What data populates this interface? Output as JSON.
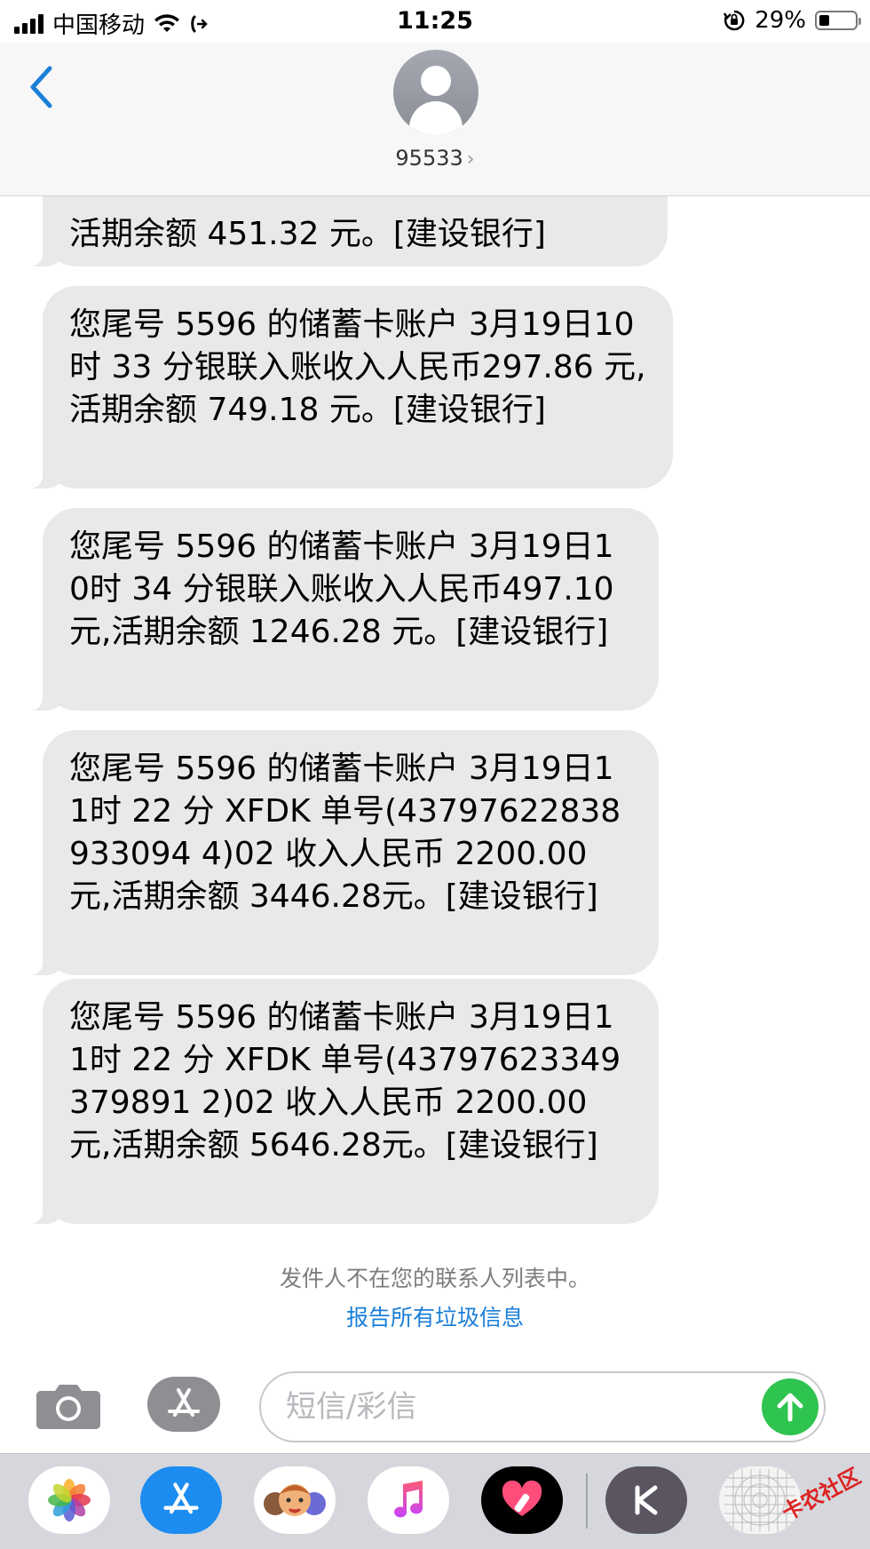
{
  "status_bar": {
    "carrier": "中国移动",
    "time": "11:25",
    "battery_percent": "29%",
    "battery_level": 0.29
  },
  "header": {
    "contact": "95533"
  },
  "messages": [
    "活期余额 451.32 元。[建设银行]",
    "您尾号 5596 的储蓄卡账户 3月19日10时 33 分银联入账收入人民币297.86 元,活期余额 749.18 元。[建设银行]",
    "您尾号 5596 的储蓄卡账户 3月19日10时 34 分银联入账收入人民币497.10 元,活期余额 1246.28 元。[建设银行]",
    "您尾号 5596 的储蓄卡账户 3月19日11时 22 分 XFDK 单号(43797622838933094 4)02 收入人民币 2200.00 元,活期余额 3446.28元。[建设银行]",
    "您尾号 5596 的储蓄卡账户 3月19日11时 22 分 XFDK 单号(43797623349379891 2)02 收入人民币 2200.00 元,活期余额 5646.28元。[建设银行]"
  ],
  "footer": {
    "not_in_contacts": "发件人不在您的联系人列表中。",
    "report_link": "报告所有垃圾信息"
  },
  "composer": {
    "placeholder": "短信/彩信"
  },
  "watermark": "卡农社区",
  "colors": {
    "bubble": "#e9e9eb",
    "accent_blue": "#1b7fd9",
    "send_green": "#2fc34f"
  },
  "icons": {
    "back": "chevron-left-icon",
    "camera": "camera-icon",
    "appstore": "app-store-icon",
    "send": "arrow-up-icon"
  }
}
